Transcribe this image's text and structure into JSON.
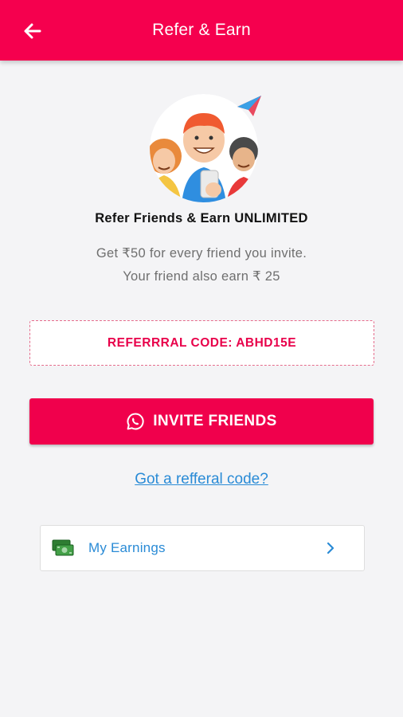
{
  "appbar": {
    "title": "Refer & Earn",
    "back_icon": "arrow-left-icon"
  },
  "hero": {
    "illustration": "friends-illustration",
    "plane_icon": "paper-plane-icon"
  },
  "headline": "Refer Friends & Earn UNLIMITED",
  "subtitle_line1": "Get ₹50 for every friend you invite.",
  "subtitle_line2": "Your friend also earn ₹ 25",
  "referral_code_text": "REFERRRAL CODE: ABHD15E",
  "invite_button": {
    "label": "INVITE FRIENDS",
    "icon": "whatsapp-icon"
  },
  "referral_link": "Got a refferal code?",
  "earnings": {
    "label": "My Earnings",
    "icon": "money-icon",
    "chevron": "chevron-right-icon"
  },
  "colors": {
    "primary": "#f5004e",
    "link": "#2a8bd6",
    "code_text": "#e8004a"
  }
}
